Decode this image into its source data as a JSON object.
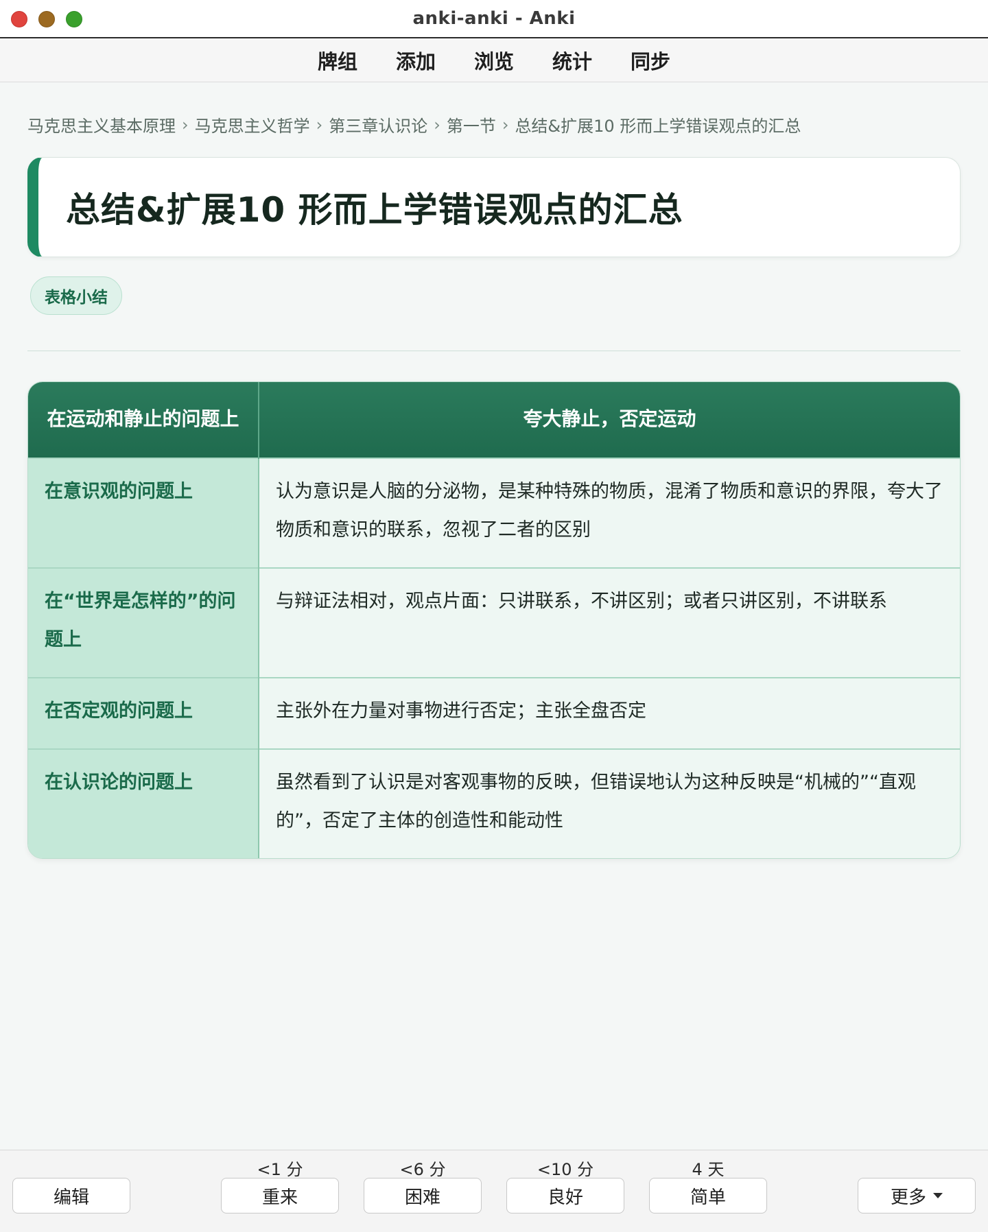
{
  "window": {
    "title": "anki-anki - Anki"
  },
  "nav": {
    "items": [
      "牌组",
      "添加",
      "浏览",
      "统计",
      "同步"
    ]
  },
  "breadcrumb": [
    "马克思主义基本原理",
    "马克思主义哲学",
    "第三章认识论",
    "第一节",
    "总结&扩展10 形而上学错误观点的汇总"
  ],
  "breadcrumb_separator": "›",
  "card": {
    "title": "总结&扩展10 形而上学错误观点的汇总",
    "tag": "表格小结",
    "table": {
      "header": [
        "在运动和静止的问题上",
        "夸大静止，否定运动"
      ],
      "rows": [
        [
          "在意识观的问题上",
          "认为意识是人脑的分泌物，是某种特殊的物质，混淆了物质和意识的界限，夸大了物质和意识的联系，忽视了二者的区别"
        ],
        [
          "在“世界是怎样的”的问题上",
          "与辩证法相对，观点片面：只讲联系，不讲区别；或者只讲区别，不讲联系"
        ],
        [
          "在否定观的问题上",
          "主张外在力量对事物进行否定；主张全盘否定"
        ],
        [
          "在认识论的问题上",
          "虽然看到了认识是对客观事物的反映，但错误地认为这种反映是“机械的”“直观的”，否定了主体的创造性和能动性"
        ]
      ]
    }
  },
  "bottom": {
    "edit": "编辑",
    "answers": [
      {
        "label": "重来",
        "interval": "<1 分"
      },
      {
        "label": "困难",
        "interval": "<6 分"
      },
      {
        "label": "良好",
        "interval": "<10 分"
      },
      {
        "label": "简单",
        "interval": "4 天"
      }
    ],
    "more": "更多"
  },
  "colors": {
    "accent": "#1e8a62",
    "header_green": "#1f6b4e",
    "key_cell": "#c4e8d8",
    "value_cell": "#eef7f3"
  }
}
